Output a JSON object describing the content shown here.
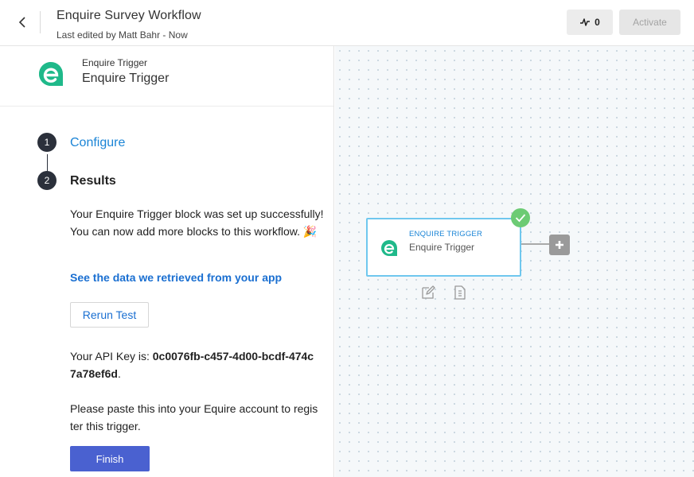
{
  "header": {
    "title": "Enquire Survey Workflow",
    "subtitle": "Last edited by Matt Bahr - Now",
    "history_count": "0",
    "activate_label": "Activate"
  },
  "block": {
    "small_label": "Enquire Trigger",
    "name": "Enquire Trigger"
  },
  "steps": [
    {
      "number": "1",
      "label": "Configure"
    },
    {
      "number": "2",
      "label": "Results"
    }
  ],
  "results": {
    "success_text": "Your Enquire Trigger block was set up successfully! You can now add more blocks to this workflow. 🎉",
    "data_link": "See the data we retrieved from your app",
    "rerun_label": "Rerun Test",
    "api_key_prefix": "Your API Key is: ",
    "api_key": "0c0076fb-c457-4d00-bcdf-474c7a78ef6d",
    "api_key_suffix": ".",
    "paste_instruction": "Please paste this into your Equire account to register this trigger.",
    "finish_label": "Finish"
  },
  "canvas": {
    "node_type": "ENQUIRE TRIGGER",
    "node_name": "Enquire Trigger"
  },
  "colors": {
    "accent": "#1a84d6",
    "brand_green": "#1fb98a",
    "finish_button": "#4a61d0",
    "success_check": "#6ccb74"
  },
  "icons": {
    "back": "chevron-left-icon",
    "history": "activity-icon",
    "logo": "enquire-logo",
    "check": "check-icon",
    "add": "plus-icon",
    "edit": "edit-icon",
    "document": "document-icon"
  }
}
